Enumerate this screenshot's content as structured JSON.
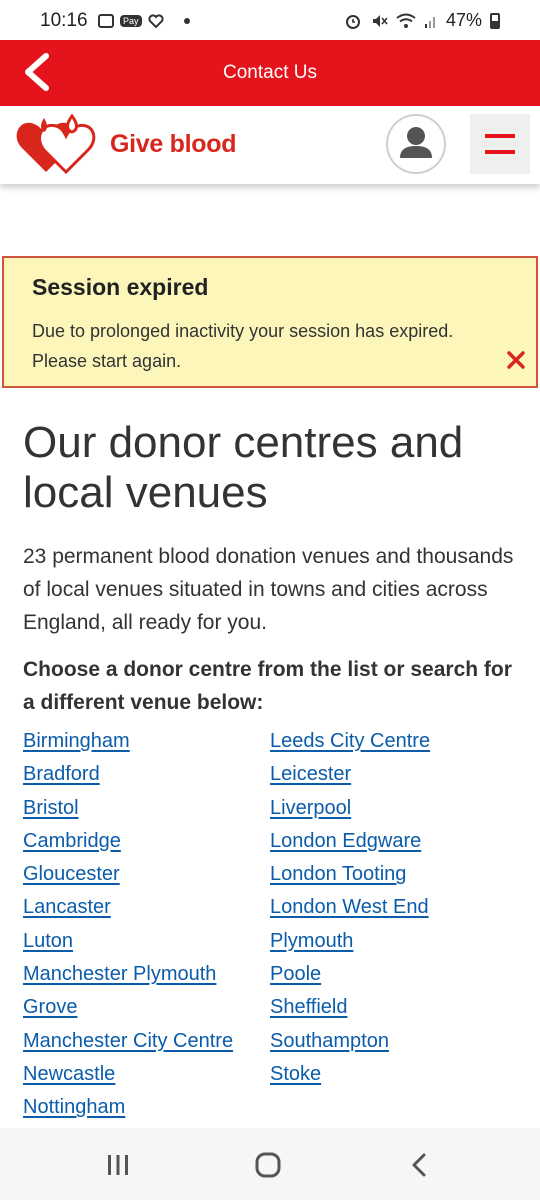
{
  "status_bar": {
    "time": "10:16",
    "pay_label": "Pay",
    "battery": "47%"
  },
  "app_bar": {
    "title": "Contact Us"
  },
  "site_header": {
    "brand": "Give blood"
  },
  "alert": {
    "title": "Session expired",
    "message": "Due to prolonged inactivity your session has expired. Please start again."
  },
  "main": {
    "heading": "Our donor centres and local venues",
    "lead": "23 permanent blood donation venues and thousands of local venues situated in towns and cities across England, all ready for you.",
    "choose": "Choose a donor centre from the list or search for a different venue below:",
    "left_links": [
      "Birmingham",
      "Bradford",
      "Bristol",
      "Cambridge",
      "Gloucester",
      "Lancaster",
      "Luton",
      "Manchester Plymouth",
      "Grove",
      "Manchester City Centre",
      "Newcastle",
      "Nottingham"
    ],
    "right_links": [
      "Leeds City Centre",
      "Leicester",
      "Liverpool",
      "London Edgware",
      "London Tooting",
      "London West End",
      "Plymouth",
      "Poole",
      "Sheffield",
      "Southampton",
      "Stoke"
    ]
  },
  "colors": {
    "brand_red": "#e5131b",
    "link_blue": "#0b5cab",
    "alert_bg": "#fcf6bb"
  }
}
